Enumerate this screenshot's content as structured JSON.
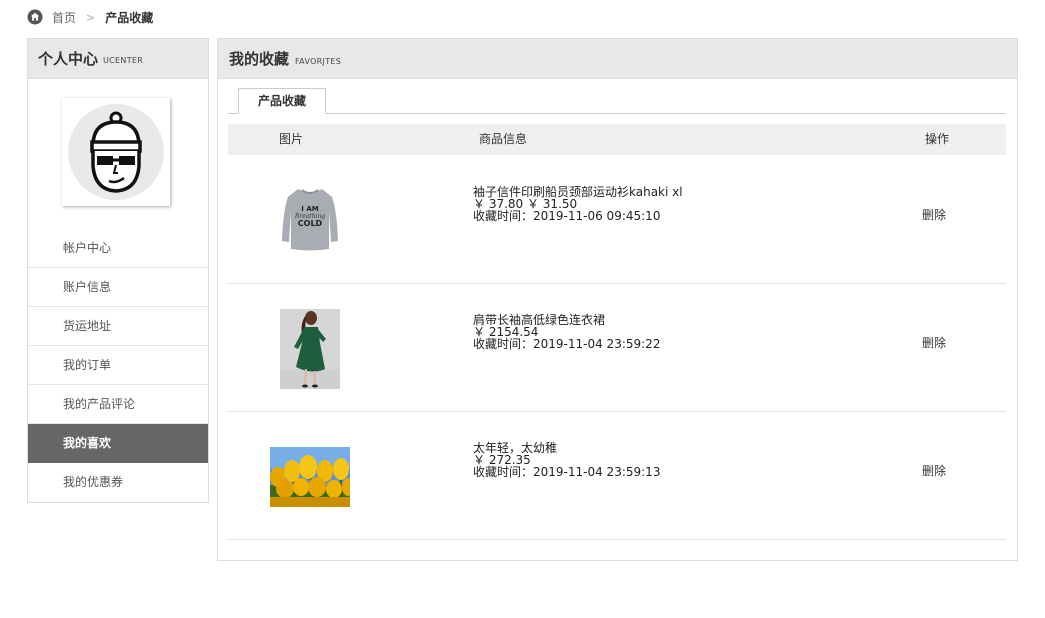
{
  "breadcrumb": {
    "home": "首页",
    "separator": ">",
    "current": "产品收藏"
  },
  "sidebar": {
    "title": "个人中心",
    "subtitle": "UCENTER",
    "items": [
      {
        "label": "帐户中心"
      },
      {
        "label": "账户信息"
      },
      {
        "label": "货运地址"
      },
      {
        "label": "我的订单"
      },
      {
        "label": "我的产品评论"
      },
      {
        "label": "我的喜欢",
        "active": true
      },
      {
        "label": "我的优惠券"
      }
    ]
  },
  "main": {
    "title": "我的收藏",
    "subtitle": "FAVORJTES",
    "tab": "产品收藏",
    "columns": {
      "image": "图片",
      "info": "商品信息",
      "action": "操作"
    },
    "rows": [
      {
        "name": "袖子信件印刷船员颈部运动衫kahaki xl",
        "price": "￥ 37.80 ￥ 31.50",
        "time": "收藏时间：2019-11-06 09:45:10",
        "action": "删除",
        "image": "sweatshirt"
      },
      {
        "name": "肩带长袖高低绿色连衣裙",
        "price": "￥ 2154.54",
        "time": "收藏时间：2019-11-04 23:59:22",
        "action": "删除",
        "image": "green-dress"
      },
      {
        "name": "太年轻，太幼稚",
        "price": "￥ 272.35",
        "time": "收藏时间：2019-11-04 23:59:13",
        "action": "删除",
        "image": "tulips"
      }
    ],
    "sweatshirt_text": [
      "I AM",
      "Breathing",
      "COLD"
    ]
  }
}
